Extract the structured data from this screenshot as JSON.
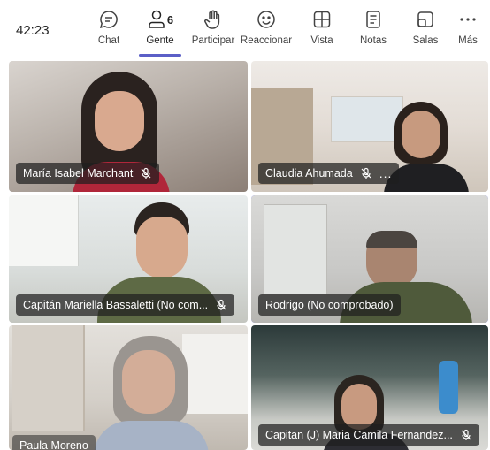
{
  "toolbar": {
    "timer": "42:23",
    "participant_count": "6",
    "items": [
      {
        "label": "Chat",
        "icon": "chat-icon"
      },
      {
        "label": "Gente",
        "icon": "people-icon"
      },
      {
        "label": "Participar",
        "icon": "raise-hand-icon"
      },
      {
        "label": "Reaccionar",
        "icon": "smiley-icon"
      },
      {
        "label": "Vista",
        "icon": "grid-view-icon"
      },
      {
        "label": "Notas",
        "icon": "notes-icon"
      },
      {
        "label": "Salas",
        "icon": "rooms-icon"
      },
      {
        "label": "Más",
        "icon": "more-icon"
      }
    ],
    "active_item": "Gente",
    "accent_color": "#5b5fc7"
  },
  "participants": [
    {
      "name": "María Isabel Marchant",
      "muted": true
    },
    {
      "name": "Claudia Ahumada",
      "muted": true,
      "more_menu": "..."
    },
    {
      "name": "Capitán Mariella Bassaletti (No com...",
      "muted": true
    },
    {
      "name": "Rodrigo (No comprobado)",
      "muted": false,
      "speaking": true
    },
    {
      "name": "Paula Moreno",
      "muted": false
    },
    {
      "name": "Capitan (J) Maria Camila Fernandez...",
      "muted": true
    }
  ]
}
